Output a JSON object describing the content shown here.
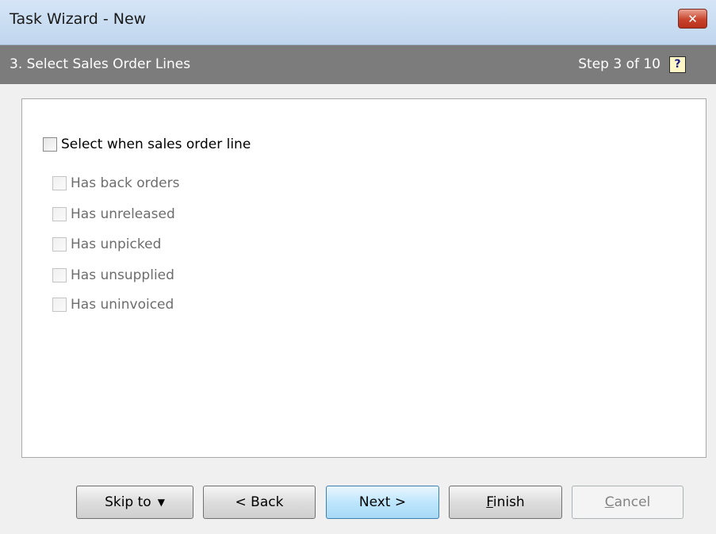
{
  "window": {
    "title": "Task Wizard - New",
    "close_glyph": "✕"
  },
  "header": {
    "step_title": "3. Select Sales Order Lines",
    "step_count": "Step 3 of 10",
    "help_glyph": "?"
  },
  "options": {
    "main": {
      "label": "Select when sales order line",
      "checked": false
    },
    "sub_items": [
      {
        "label": "Has back orders",
        "checked": false,
        "enabled": false
      },
      {
        "label": "Has unreleased",
        "checked": false,
        "enabled": false
      },
      {
        "label": "Has unpicked",
        "checked": false,
        "enabled": false
      },
      {
        "label": "Has unsupplied",
        "checked": false,
        "enabled": false
      },
      {
        "label": "Has uninvoiced",
        "checked": false,
        "enabled": false
      }
    ]
  },
  "buttons": {
    "skip_to": "Skip to",
    "skip_to_arrow": "▼",
    "back": "< Back",
    "next": "Next >",
    "finish_mnemonic": "F",
    "finish_rest": "inish",
    "cancel_mnemonic": "C",
    "cancel_rest": "ancel"
  }
}
